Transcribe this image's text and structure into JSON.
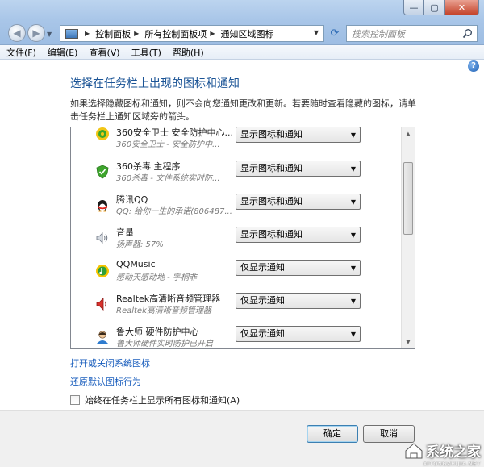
{
  "nav": {
    "back_icon": "back-arrow-icon",
    "forward_icon": "forward-arrow-icon"
  },
  "address": {
    "crumbs": [
      "控制面板",
      "所有控制面板项",
      "通知区域图标"
    ]
  },
  "search": {
    "placeholder": "搜索控制面板"
  },
  "menu": [
    "文件(F)",
    "编辑(E)",
    "查看(V)",
    "工具(T)",
    "帮助(H)"
  ],
  "page": {
    "title": "选择在任务栏上出现的图标和通知",
    "description": "如果选择隐藏图标和通知，则不会向您通知更改和更新。若要随时查看隐藏的图标，请单击任务栏上通知区域旁的箭头。"
  },
  "rows": [
    {
      "name": "360安全卫士 安全防护中心...",
      "sub": "360安全卫士 - 安全防护中...",
      "behavior": "显示图标和通知",
      "icon": "360-safeguard-icon"
    },
    {
      "name": "360杀毒 主程序",
      "sub": "360杀毒 - 文件系统实时防...",
      "behavior": "显示图标和通知",
      "icon": "360-antivirus-icon"
    },
    {
      "name": "腾讯QQ",
      "sub": "QQ: 给你一生的承诺(806487...",
      "behavior": "显示图标和通知",
      "icon": "qq-penguin-icon"
    },
    {
      "name": "音量",
      "sub": "扬声器: 57%",
      "behavior": "显示图标和通知",
      "icon": "speaker-icon"
    },
    {
      "name": "QQMusic",
      "sub": "感动天感动地 - 宇桐非",
      "behavior": "仅显示通知",
      "icon": "qqmusic-icon"
    },
    {
      "name": "Realtek高清晰音频管理器",
      "sub": "Realtek高清晰音频管理器",
      "behavior": "仅显示通知",
      "icon": "realtek-speaker-icon"
    },
    {
      "name": "鲁大师 硬件防护中心",
      "sub": "鲁大师硬件实时防护已开启",
      "behavior": "仅显示通知",
      "icon": "ludashi-icon"
    }
  ],
  "links": {
    "system_icons": "打开或关闭系统图标",
    "restore_default": "还原默认图标行为"
  },
  "checkbox": {
    "label": "始终在任务栏上显示所有图标和通知(A)",
    "checked": false
  },
  "buttons": {
    "ok": "确定",
    "cancel": "取消"
  },
  "watermark": {
    "text": "系统之家",
    "sub": "XITONGZHIJIA.NET"
  }
}
